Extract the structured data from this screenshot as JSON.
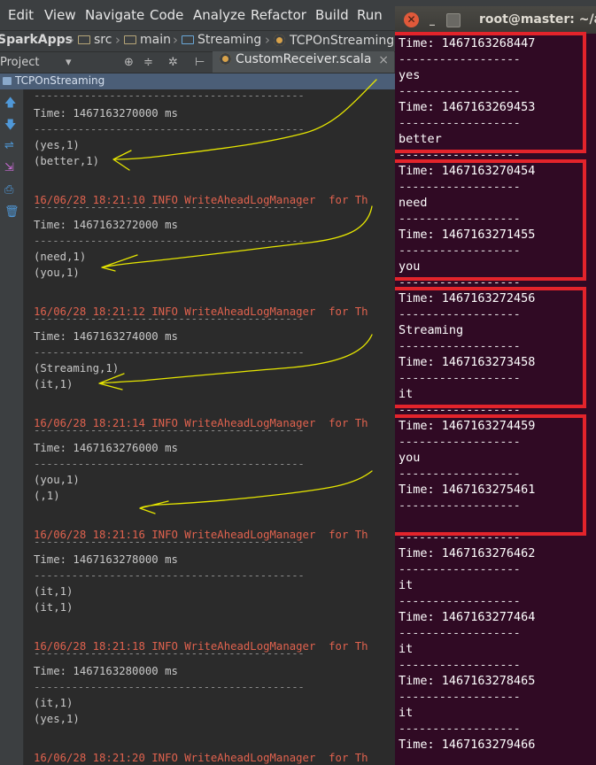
{
  "ide": {
    "menu": [
      "Edit",
      "View",
      "Navigate",
      "Code",
      "Analyze",
      "Refactor",
      "Build",
      "Run"
    ],
    "breadcrumb": [
      "SparkApps",
      "src",
      "main",
      "Streaming",
      "TCPOnStreaming"
    ],
    "project_label": "Project",
    "editor_tab": "CustomReceiver.scala",
    "run_tab": "TCPOnStreaming",
    "console": {
      "dash": "-------------------------------------------",
      "batches": [
        {
          "log": null,
          "time": "Time: 1467163270000 ms",
          "lines": [
            "(yes,1)",
            "(better,1)"
          ]
        },
        {
          "log": "16/06/28 18:21:10 INFO WriteAheadLogManager  for Th",
          "time": "Time: 1467163272000 ms",
          "lines": [
            "(need,1)",
            "(you,1)"
          ]
        },
        {
          "log": "16/06/28 18:21:12 INFO WriteAheadLogManager  for Th",
          "time": "Time: 1467163274000 ms",
          "lines": [
            "(Streaming,1)",
            "(it,1)"
          ]
        },
        {
          "log": "16/06/28 18:21:14 INFO WriteAheadLogManager  for Th",
          "time": "Time: 1467163276000 ms",
          "lines": [
            "(you,1)",
            "(,1)"
          ]
        },
        {
          "log": "16/06/28 18:21:16 INFO WriteAheadLogManager  for Th",
          "time": "Time: 1467163278000 ms",
          "lines": [
            "(it,1)",
            "(it,1)"
          ]
        },
        {
          "log": "16/06/28 18:21:18 INFO WriteAheadLogManager  for Th",
          "time": "Time: 1467163280000 ms",
          "lines": [
            "(it,1)",
            "(yes,1)"
          ]
        },
        {
          "log": "16/06/28 18:21:20 INFO WriteAheadLogManager  for Th",
          "time": null,
          "lines": []
        }
      ]
    }
  },
  "terminal": {
    "title": "root@master: ~/ap",
    "dash": "------------------",
    "entries": [
      {
        "time": "Time: 1467163268447",
        "word": "yes"
      },
      {
        "time": "Time: 1467163269453",
        "word": "better"
      },
      {
        "time": "Time: 1467163270454",
        "word": "need"
      },
      {
        "time": "Time: 1467163271455",
        "word": "you"
      },
      {
        "time": "Time: 1467163272456",
        "word": "Streaming"
      },
      {
        "time": "Time: 1467163273458",
        "word": "it"
      },
      {
        "time": "Time: 1467163274459",
        "word": "you"
      },
      {
        "time": "Time: 1467163275461",
        "word": ""
      },
      {
        "time": "Time: 1467163276462",
        "word": "it"
      },
      {
        "time": "Time: 1467163277464",
        "word": "it"
      },
      {
        "time": "Time: 1467163278465",
        "word": "it"
      },
      {
        "time": "Time: 1467163279466",
        "word": null
      }
    ]
  },
  "colors": {
    "highlight_box": "#e3242b",
    "annotation_arrow": "#e6e600",
    "log_text": "#e0624e",
    "terminal_bg": "#300a24"
  }
}
